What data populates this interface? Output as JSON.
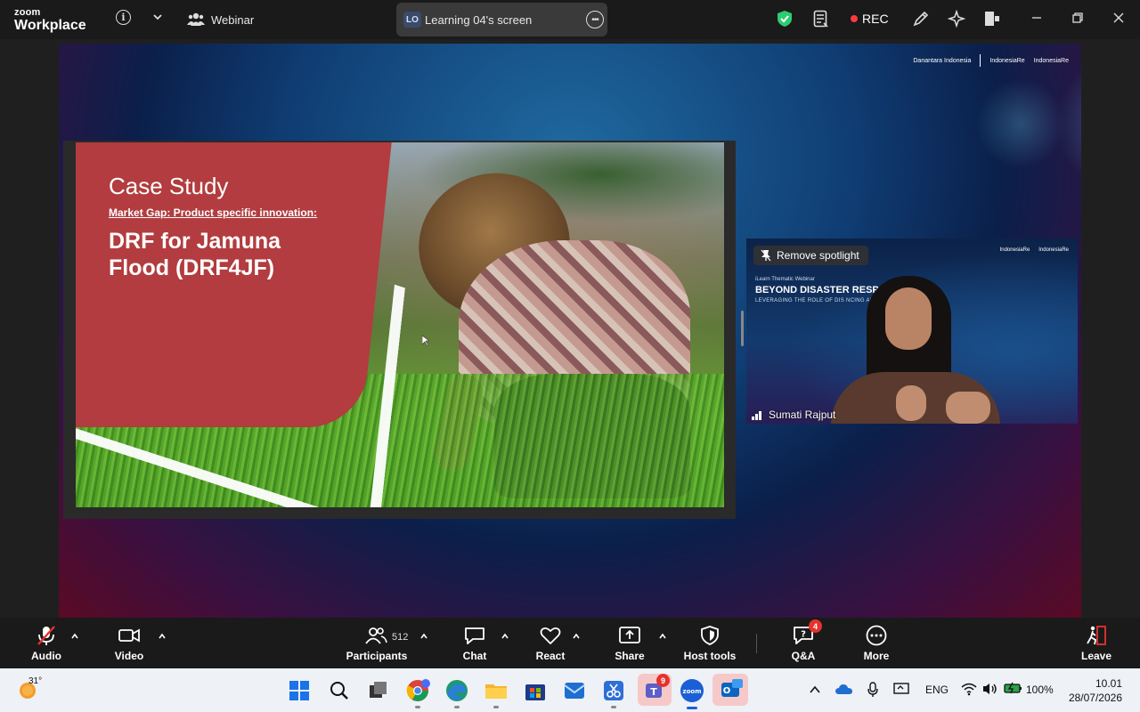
{
  "topbar": {
    "brand_line1": "zoom",
    "brand_line2": "Workplace",
    "meeting_type": "Webinar",
    "screen_badge": "LO",
    "screen_title": "Learning 04's screen",
    "rec_label": "REC"
  },
  "slide": {
    "title": "Case Study",
    "subtitle": "Market Gap: Product specific innovation:",
    "heading": "DRF for Jamuna Flood (DRF4JF)"
  },
  "logos": {
    "logo1": "Danantara Indonesia",
    "logo2": "IndonesiaRe",
    "logo3": "IndonesiaRe"
  },
  "video": {
    "remove_spotlight": "Remove spotlight",
    "participant_name": "Sumati Rajput",
    "webinar_kicker": "iLearn Thematic Webinar",
    "webinar_title": "BEYOND DISASTER RESPO",
    "webinar_tagline": "LEVERAGING THE ROLE OF DIS          NCING AND INSURANCE",
    "logo_a": "IndonesiaRe",
    "logo_b": "IndonesiaRe"
  },
  "toolbar": {
    "audio": "Audio",
    "video": "Video",
    "participants": "Participants",
    "participants_count": "512",
    "chat": "Chat",
    "react": "React",
    "share": "Share",
    "host_tools": "Host tools",
    "qa": "Q&A",
    "qa_badge": "4",
    "more": "More",
    "leave": "Leave"
  },
  "taskbar": {
    "weather_temp": "31°",
    "teams_badge": "9",
    "language": "ENG",
    "battery": "100%",
    "time": "10.01",
    "date": "28/07/2026"
  },
  "colors": {
    "toolbar_bg": "#1a1a1a",
    "shield_green": "#2ecc71",
    "rec_red": "#ff3b3b",
    "slide_red": "#b23c3f",
    "taskbar_bg": "#eef1f6"
  }
}
